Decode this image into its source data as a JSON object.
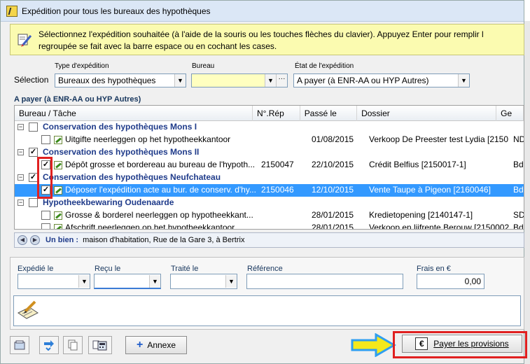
{
  "window": {
    "title": "Expédition pour tous les bureaux des hypothèques"
  },
  "info": {
    "line1": "Sélectionnez l'expédition souhaitée (à l'aide de la souris ou les touches flèches du clavier). Appuyez Enter pour remplir l",
    "line2": "regroupée se fait avec la barre espace ou en cochant les cases."
  },
  "filters": {
    "selection_label": "Sélection",
    "type_label": "Type d'expédition",
    "type_value": "Bureaux des hypothèques",
    "bureau_label": "Bureau",
    "bureau_value": "",
    "etat_label": "État de l'expédition",
    "etat_value": "A payer (à ENR-AA ou HYP Autres)"
  },
  "group_header": "A payer (à ENR-AA ou HYP Autres)",
  "grid": {
    "columns": [
      "Bureau / Tâche",
      "N°.Rép",
      "Passé le",
      "Dossier",
      "Ge"
    ],
    "rows": [
      {
        "kind": "group",
        "expander": "−",
        "checked": false,
        "label": "Conservation des hypothèques Mons I"
      },
      {
        "kind": "task",
        "checked": false,
        "label": "Uitgifte neerleggen op het hypotheekkantoor",
        "rep": "",
        "date": "01/08/2015",
        "dossier": "Verkoop De Preester test Lydia [2150",
        "ge": "ND"
      },
      {
        "kind": "group",
        "expander": "−",
        "checked": true,
        "label": "Conservation des hypothèques Mons II"
      },
      {
        "kind": "task",
        "checked": true,
        "label": "Dépôt grosse et bordereau au bureau de l'hypoth...",
        "rep": "2150047",
        "date": "22/10/2015",
        "dossier": "Crédit Belfius [2150017-1]",
        "ge": "Bdl"
      },
      {
        "kind": "group",
        "expander": "−",
        "checked": true,
        "label": "Conservation des hypothèques Neufchateau"
      },
      {
        "kind": "task",
        "selected": true,
        "checked": true,
        "label": "Déposer l'expédition acte au bur. de conserv. d'hy...",
        "rep": "2150046",
        "date": "12/10/2015",
        "dossier": "Vente Taupe à Pigeon [2160046]",
        "ge": "Bdl"
      },
      {
        "kind": "group",
        "expander": "−",
        "checked": false,
        "label": "Hypotheekbewaring Oudenaarde"
      },
      {
        "kind": "task",
        "checked": false,
        "label": "Grosse & borderel neerleggen op hypotheekkant...",
        "rep": "",
        "date": "28/01/2015",
        "dossier": "Kredietopening [2140147-1]",
        "ge": "SD"
      },
      {
        "kind": "task",
        "checked": false,
        "label": "Afschrift neerleggen op het hypotheekkantoor",
        "rep": "",
        "date": "28/01/2015",
        "dossier": "Verkoop en lijfrente Berouw [2150002",
        "ge": "Bdl"
      }
    ]
  },
  "bien": {
    "label": "Un bien :",
    "value": "maison d'habitation, Rue de la Gare 3, à Bertrix"
  },
  "form": {
    "expedie_label": "Expédié le",
    "recu_label": "Reçu le",
    "traite_label": "Traité le",
    "reference_label": "Référence",
    "frais_label": "Frais en €",
    "frais_value": "0,00"
  },
  "buttons": {
    "annexe_label": "Annexe",
    "payer_label": "Payer les provisions"
  }
}
